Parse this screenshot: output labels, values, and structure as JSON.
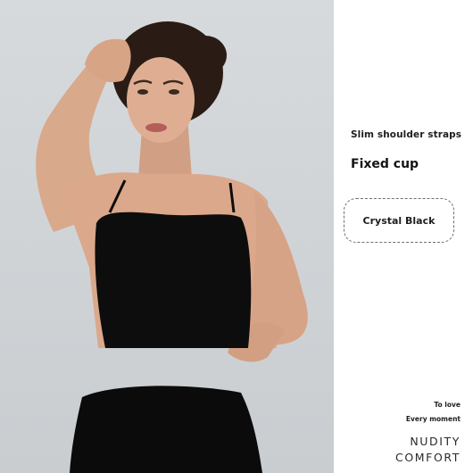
{
  "product": {
    "color_hex": "#0d0d0d",
    "background_hex": "#cfd3d6"
  },
  "features": {
    "strap": "Slim shoulder straps",
    "cup": "Fixed cup"
  },
  "color_option": {
    "label": "Crystal Black"
  },
  "tagline": {
    "line1": "To love",
    "line2": "Every moment"
  },
  "brand": {
    "line1": "NUDITY",
    "line2": "COMFORT"
  }
}
